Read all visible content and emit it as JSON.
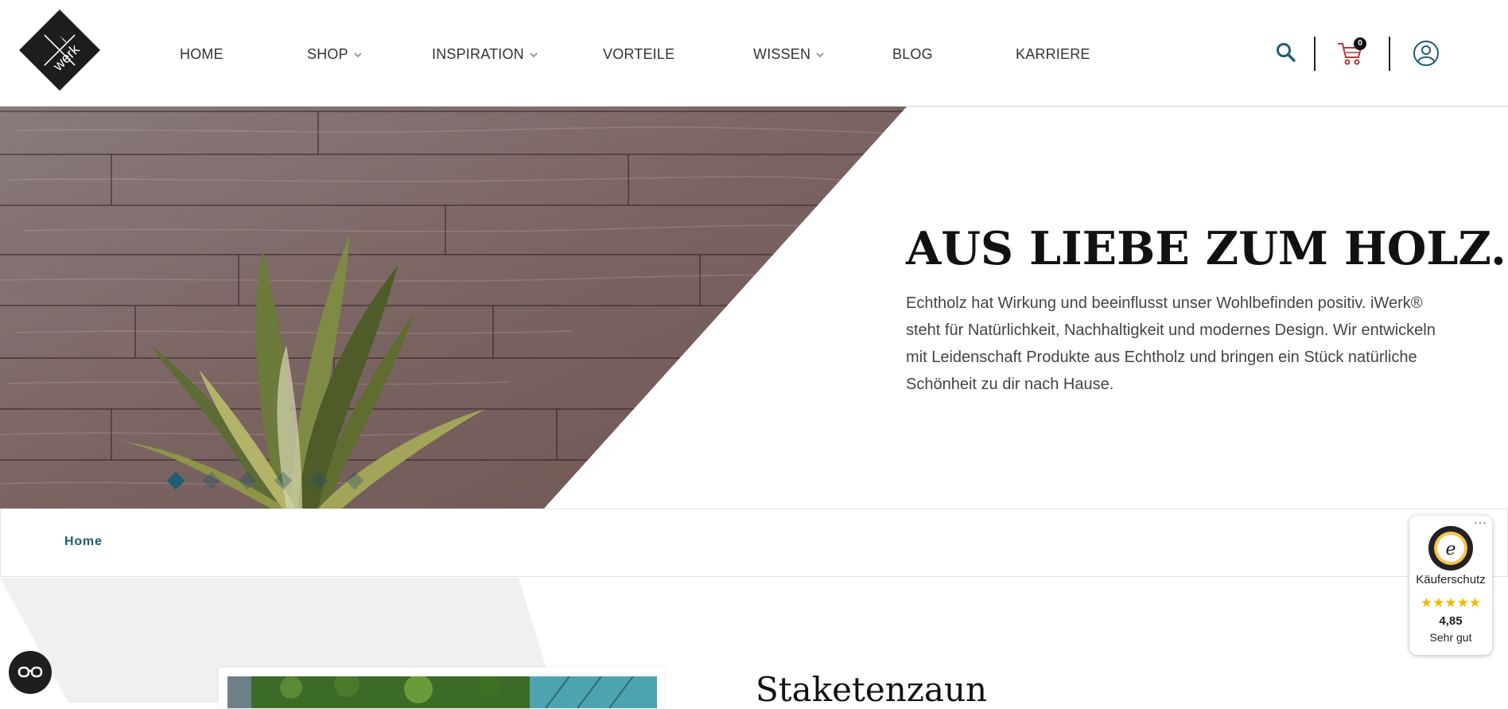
{
  "header": {
    "logo_text": "i werk",
    "nav": [
      {
        "label": "HOME",
        "has_dropdown": false
      },
      {
        "label": "SHOP",
        "has_dropdown": true
      },
      {
        "label": "INSPIRATION",
        "has_dropdown": true
      },
      {
        "label": "VORTEILE",
        "has_dropdown": false
      },
      {
        "label": "WISSEN",
        "has_dropdown": true
      },
      {
        "label": "BLOG",
        "has_dropdown": false
      },
      {
        "label": "KARRIERE",
        "has_dropdown": false
      }
    ],
    "icons": {
      "search": "search-icon",
      "cart": "cart-icon",
      "account": "user-icon"
    },
    "cart_count": "0",
    "colors": {
      "accent": "#1f5f73",
      "cart": "#b23a3a"
    }
  },
  "hero": {
    "title": "AUS LIEBE ZUM HOLZ.",
    "text": "Echtholz hat Wirkung und beeinflusst unser Wohlbefinden positiv. iWerk® steht für Natürlichkeit, Nachhaltigkeit und modernes Design. Wir entwickeln mit Leidenschaft Produkte aus Echtholz und bringen ein Stück natürliche Schönheit zu dir nach Hause.",
    "slides": 6,
    "active_slide": 1
  },
  "breadcrumb": {
    "home": "Home"
  },
  "section": {
    "title": "Staketenzaun"
  },
  "trusted_shops": {
    "label": "Käuferschutz",
    "stars": "★★★★★",
    "score": "4,85",
    "grade": "Sehr gut"
  }
}
